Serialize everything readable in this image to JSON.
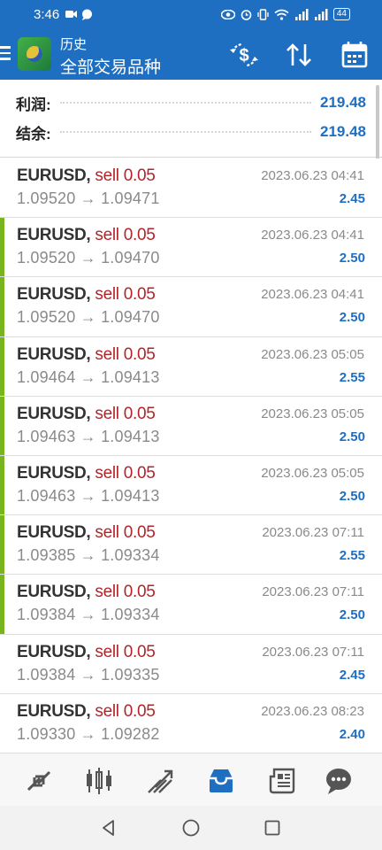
{
  "status_bar": {
    "time": "3:46",
    "battery": "44",
    "icons": [
      "video-icon",
      "chat-bubble-icon",
      "eye-icon",
      "alarm-icon",
      "vibrate-icon",
      "wifi-icon",
      "signal-icon",
      "signal-icon"
    ]
  },
  "app_bar": {
    "subtitle": "历史",
    "title": "全部交易品种",
    "actions": [
      "currency-exchange-icon",
      "sort-icon",
      "calendar-icon"
    ],
    "color": "#1e6fc2"
  },
  "summary": {
    "profit_label": "利润:",
    "profit_value": "219.48",
    "balance_label": "结余:",
    "balance_value": "219.48"
  },
  "trades": [
    {
      "symbol": "EURUSD,",
      "side": "sell 0.05",
      "open": "1.09520",
      "close": "1.09471",
      "time": "2023.06.23 04:41",
      "profit": "2.45",
      "marked": false
    },
    {
      "symbol": "EURUSD,",
      "side": "sell 0.05",
      "open": "1.09520",
      "close": "1.09470",
      "time": "2023.06.23 04:41",
      "profit": "2.50",
      "marked": true
    },
    {
      "symbol": "EURUSD,",
      "side": "sell 0.05",
      "open": "1.09520",
      "close": "1.09470",
      "time": "2023.06.23 04:41",
      "profit": "2.50",
      "marked": true
    },
    {
      "symbol": "EURUSD,",
      "side": "sell 0.05",
      "open": "1.09464",
      "close": "1.09413",
      "time": "2023.06.23 05:05",
      "profit": "2.55",
      "marked": true
    },
    {
      "symbol": "EURUSD,",
      "side": "sell 0.05",
      "open": "1.09463",
      "close": "1.09413",
      "time": "2023.06.23 05:05",
      "profit": "2.50",
      "marked": true
    },
    {
      "symbol": "EURUSD,",
      "side": "sell 0.05",
      "open": "1.09463",
      "close": "1.09413",
      "time": "2023.06.23 05:05",
      "profit": "2.50",
      "marked": true
    },
    {
      "symbol": "EURUSD,",
      "side": "sell 0.05",
      "open": "1.09385",
      "close": "1.09334",
      "time": "2023.06.23 07:11",
      "profit": "2.55",
      "marked": true
    },
    {
      "symbol": "EURUSD,",
      "side": "sell 0.05",
      "open": "1.09384",
      "close": "1.09334",
      "time": "2023.06.23 07:11",
      "profit": "2.50",
      "marked": true
    },
    {
      "symbol": "EURUSD,",
      "side": "sell 0.05",
      "open": "1.09384",
      "close": "1.09335",
      "time": "2023.06.23 07:11",
      "profit": "2.45",
      "marked": false
    },
    {
      "symbol": "EURUSD,",
      "side": "sell 0.05",
      "open": "1.09330",
      "close": "1.09282",
      "time": "2023.06.23 08:23",
      "profit": "2.40",
      "marked": false
    }
  ],
  "arrow": "→",
  "bottom_nav": {
    "items": [
      "quotes-icon",
      "chart-icon",
      "trade-icon",
      "history-icon",
      "news-icon",
      "chat-icon"
    ],
    "active": "history-icon",
    "active_color": "#1e6fc2",
    "inactive_color": "#555555"
  },
  "system_nav": [
    "back-icon",
    "home-icon",
    "recents-icon"
  ]
}
